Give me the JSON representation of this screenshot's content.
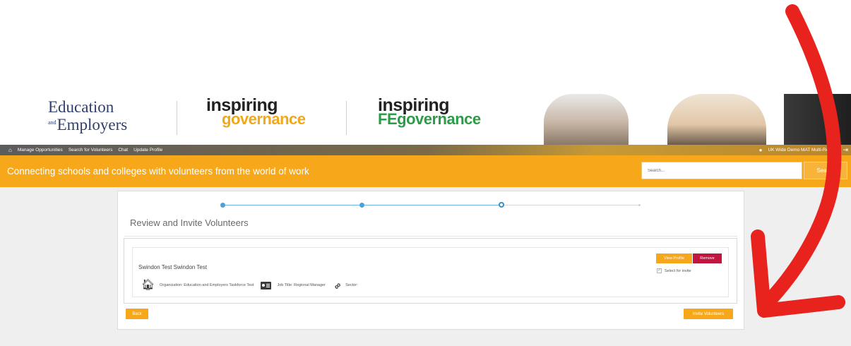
{
  "brand": {
    "ee_logo_line1": "Education",
    "ee_logo_and": "and",
    "ee_logo_line2": "Employers",
    "ig_logo_top": "inspiring",
    "ig_logo_bottom": "governance",
    "igfe_logo_top": "inspiring",
    "igfe_logo_fe": "FE",
    "igfe_logo_bottom": "governance"
  },
  "nav": {
    "items": [
      {
        "label": "Manage Opportunities"
      },
      {
        "label": "Search for Volunteers"
      },
      {
        "label": "Chat"
      },
      {
        "label": "Update Profile"
      }
    ],
    "user_label": "UK Wide Demo MAT Multi-Recruit"
  },
  "header": {
    "tagline": "Connecting schools and colleges with volunteers from the world of work",
    "search_placeholder": "Search...",
    "search_button": "Search"
  },
  "wizard": {
    "title": "Review and Invite Volunteers",
    "steps": [
      {
        "state": "done"
      },
      {
        "state": "done"
      },
      {
        "state": "current"
      },
      {
        "state": "pending"
      }
    ]
  },
  "volunteer": {
    "name": "Swindon Test Swindon Test",
    "organization": "Organization: Education and Employers Taskforce Test",
    "job_title": "Job Title: Regional Manager",
    "sector": "Sector:",
    "view_profile_label": "View Profile",
    "remove_label": "Remove",
    "select_label": "Select for invite",
    "selected": true
  },
  "actions": {
    "back_label": "Back",
    "invite_label": "Invite Volunteers"
  },
  "colors": {
    "accent_orange": "#f7a81a",
    "remove_red": "#c0163f",
    "step_blue": "#4aa3d8",
    "annotation_red": "#e8231e"
  },
  "icons": {
    "nav_home": "home-icon",
    "user": "user-icon",
    "logout": "logout-icon",
    "organization": "home-icon",
    "job_title": "id-badge-icon",
    "sector": "link-icon"
  }
}
